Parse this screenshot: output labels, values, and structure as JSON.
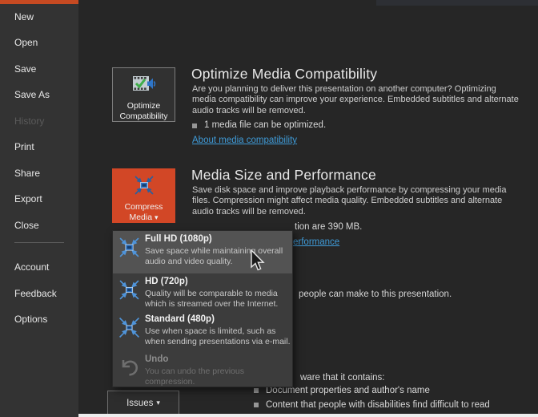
{
  "ui": {
    "caret": "▾"
  },
  "colors": {
    "accent_orange": "#d24726",
    "sidebar_accent": "#c64a22",
    "link_blue": "#3f9bd8",
    "content_bg": "#262626",
    "sidebar_bg": "#333333",
    "dropdown_bg": "#3c3c3c",
    "dropdown_highlight": "#535353"
  },
  "sidebar": {
    "items": [
      {
        "label": "New",
        "enabled": true
      },
      {
        "label": "Open",
        "enabled": true
      },
      {
        "label": "Save",
        "enabled": true
      },
      {
        "label": "Save As",
        "enabled": true
      },
      {
        "label": "History",
        "enabled": false
      },
      {
        "label": "Print",
        "enabled": true
      },
      {
        "label": "Share",
        "enabled": true
      },
      {
        "label": "Export",
        "enabled": true
      },
      {
        "label": "Close",
        "enabled": true
      }
    ],
    "footer_items": [
      {
        "label": "Account"
      },
      {
        "label": "Feedback"
      },
      {
        "label": "Options"
      }
    ]
  },
  "optimize_section": {
    "button_label": "Optimize Compatibility",
    "button_icon": "film-check-speaker-icon",
    "title": "Optimize Media Compatibility",
    "description": "Are you planning to deliver this presentation on another computer? Optimizing\nmedia compatibility can improve your experience. Embedded subtitles and alternate\naudio tracks will be removed.",
    "bullet": "1 media file can be optimized.",
    "link": "About media compatibility"
  },
  "media_section": {
    "button_label": "Compress Media",
    "button_icon": "compress-media-icon",
    "title": "Media Size and Performance",
    "description": "Save disk space and improve playback performance by compressing your media\nfiles. Compression might affect media quality. Embedded subtitles and alternate\naudio tracks will be removed.",
    "bullet_visible_fragment": "tion are 390 MB.",
    "link_visible_fragment": "erformance"
  },
  "compress_dropdown": {
    "items": [
      {
        "title": "Full HD (1080p)",
        "description": "Save space while maintaining overall\naudio and video quality.",
        "state": "hovered",
        "icon": "compress-film-icon"
      },
      {
        "title": "HD (720p)",
        "description": "Quality will be comparable to media\nwhich is streamed over the Internet.",
        "state": "normal",
        "icon": "compress-film-icon"
      },
      {
        "title": "Standard (480p)",
        "description": "Use when space is limited, such as\nwhen sending presentations via e-mail.",
        "state": "normal",
        "icon": "compress-film-icon"
      },
      {
        "title": "Undo",
        "description": "You can undo the previous\ncompression.",
        "state": "disabled",
        "icon": "undo-arrow-icon"
      }
    ]
  },
  "protect_section": {
    "visible_fragment": "people can make to this presentation."
  },
  "inspect_section": {
    "intro_visible_fragment": "ware that it contains:",
    "bullets": [
      "Document properties and author's name",
      "Content that people with disabilities find difficult to read"
    ],
    "issues_button_label": "Issues"
  }
}
